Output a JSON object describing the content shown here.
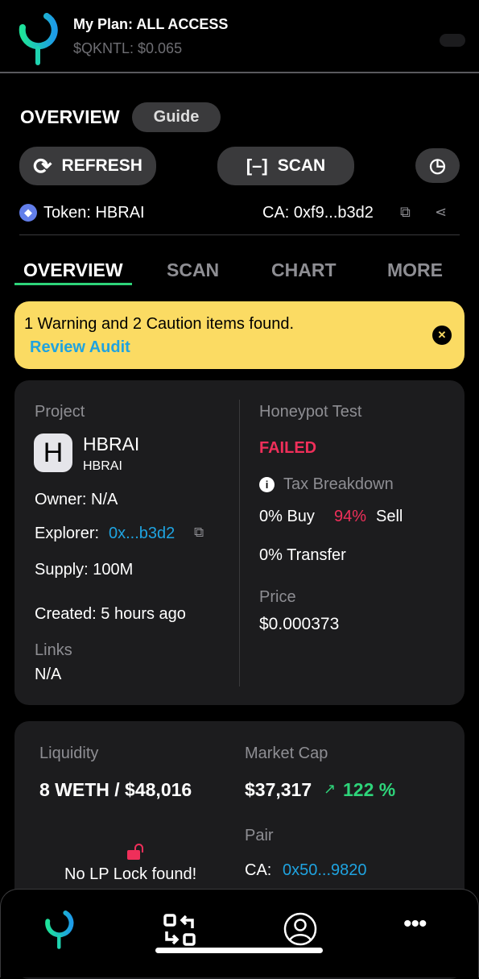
{
  "header": {
    "plan": "My Plan: ALL ACCESS",
    "token_price": "$QKNTL: $0.065"
  },
  "page": {
    "title": "OVERVIEW",
    "guide": "Guide"
  },
  "toolbar": {
    "refresh": "REFRESH",
    "scan": "SCAN"
  },
  "token": {
    "label": "Token: HBRAI",
    "ca": "CA: 0xf9...b3d2"
  },
  "tabs": [
    "OVERVIEW",
    "SCAN",
    "CHART",
    "MORE"
  ],
  "alert": {
    "message": "1 Warning and 2 Caution items found.",
    "link": "Review Audit"
  },
  "project": {
    "heading": "Project",
    "avatar_letter": "H",
    "name": "HBRAI",
    "symbol": "HBRAI",
    "owner": "Owner: N/A",
    "explorer_label": "Explorer:",
    "explorer_value": "0x...b3d2",
    "supply": "Supply: 100M",
    "created": "Created: 5 hours ago",
    "links_label": "Links",
    "links_value": "N/A"
  },
  "honeypot": {
    "heading": "Honeypot Test",
    "status": "FAILED",
    "tax_heading": "Tax Breakdown",
    "buy": "0% Buy",
    "sell_pct": "94%",
    "sell": "Sell",
    "transfer": "0% Transfer",
    "price_label": "Price",
    "price": "$0.000373"
  },
  "market": {
    "liquidity_label": "Liquidity",
    "liquidity": "8 WETH / $48,016",
    "mcap_label": "Market Cap",
    "mcap": "$37,317",
    "change": "122 %",
    "lp_lock": "No LP Lock found!",
    "pair_label": "Pair",
    "pair_ca_label": "CA:",
    "pair_ca": "0x50...9820"
  },
  "colors": {
    "accent": "#2ed47a",
    "danger": "#ef2f5a",
    "link": "#1fa3e0",
    "alert_bg": "#fbdb63"
  }
}
